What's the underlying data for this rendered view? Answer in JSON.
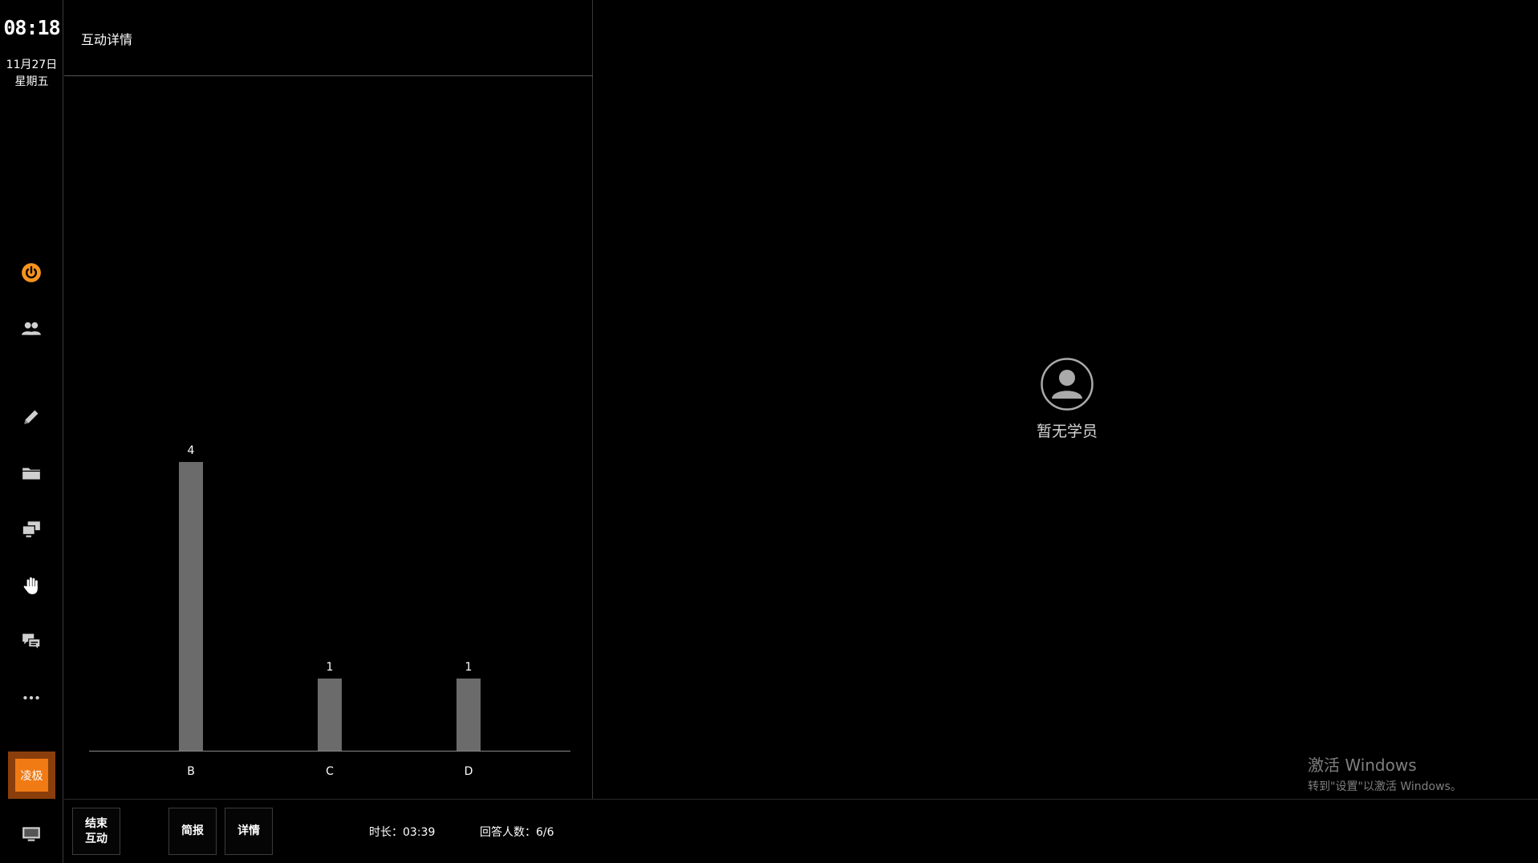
{
  "sidebar": {
    "time": "08:18",
    "date": "11月27日",
    "weekday": "星期五",
    "icons": [
      "power-icon",
      "group-icon",
      "pencil-icon",
      "folder-icon",
      "screens-icon",
      "hand-icon",
      "chat-icon",
      "more-icon",
      "monitor-icon"
    ],
    "app_tile_label": "凌极",
    "accent_color": "#f7941d"
  },
  "panel": {
    "title": "互动详情"
  },
  "chart_data": {
    "type": "bar",
    "categories": [
      "B",
      "C",
      "D"
    ],
    "values": [
      4,
      1,
      1
    ],
    "title": "",
    "xlabel": "",
    "ylabel": "",
    "ylim": [
      0,
      4
    ],
    "grid": false,
    "bar_color": "#6b6b6b"
  },
  "empty_state": {
    "label": "暂无学员"
  },
  "watermark": {
    "title": "激活 Windows",
    "subtitle": "转到\"设置\"以激活 Windows。"
  },
  "bottom_bar": {
    "end_button": "结束\n互动",
    "brief_button": "简报",
    "detail_button": "详情",
    "duration": "时长：03:39",
    "respondents": "回答人数：6/6"
  }
}
